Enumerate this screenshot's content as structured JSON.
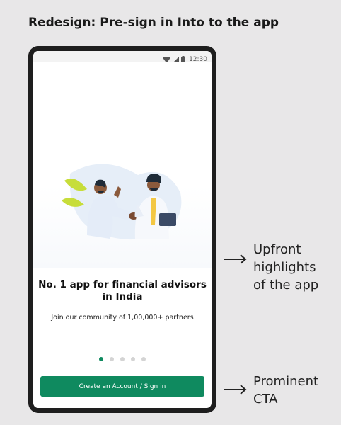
{
  "heading": "Redesign: Pre-sign in Into to the app",
  "status_bar": {
    "time": "12:30",
    "icons": [
      "wifi-icon",
      "signal-icon",
      "battery-icon"
    ]
  },
  "onboarding": {
    "headline": "No. 1 app for financial advisors in India",
    "subline": "Join our community of 1,00,000+ partners",
    "pager": {
      "total": 5,
      "active": 1
    },
    "cta_label": "Create an Account / Sign in"
  },
  "annotations": [
    {
      "text": "Upfront highlights of the app"
    },
    {
      "text": "Prominent CTA"
    }
  ],
  "colors": {
    "accent": "#0f8a5f",
    "background": "#e8e7e8",
    "phone_frame": "#1e1e1e"
  }
}
